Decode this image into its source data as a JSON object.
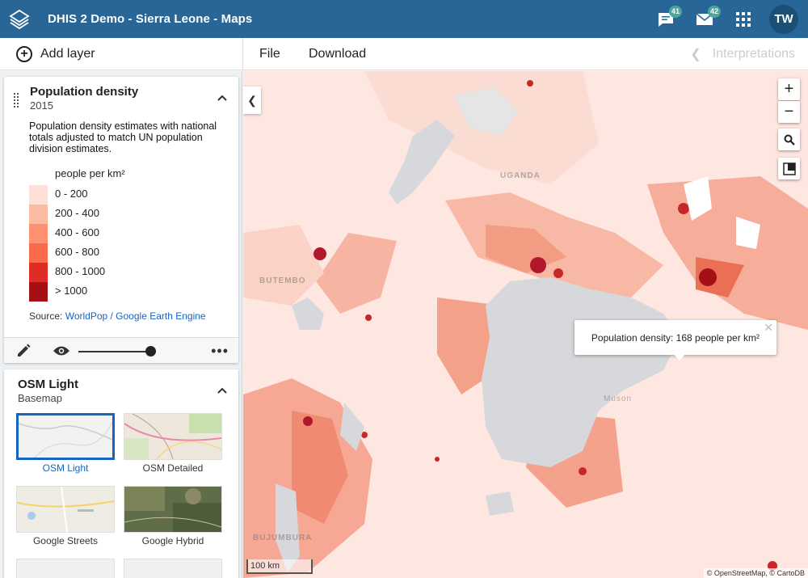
{
  "app": {
    "title": "DHIS 2 Demo - Sierra Leone - Maps",
    "messages_count": "41",
    "interpretations_count": "42",
    "user_initials": "TW"
  },
  "toolbar": {
    "add_layer": "Add layer",
    "file": "File",
    "download": "Download",
    "interpretations": "Interpretations"
  },
  "layer": {
    "title": "Population density",
    "period": "2015",
    "description": "Population density estimates with national totals adjusted to match UN population division estimates.",
    "legend_unit": "people per km²",
    "legend": [
      {
        "label": "0 - 200",
        "color": "#fee0d8"
      },
      {
        "label": "200 - 400",
        "color": "#fcbba1"
      },
      {
        "label": "400 - 600",
        "color": "#fc9272"
      },
      {
        "label": "600 - 800",
        "color": "#fb6a4a"
      },
      {
        "label": "800 - 1000",
        "color": "#de2d26"
      },
      {
        "label": "> 1000",
        "color": "#a50f15"
      }
    ],
    "source_prefix": "Source:",
    "source_link": "WorldPop / Google Earth Engine",
    "opacity": 0.9
  },
  "basemap": {
    "title": "OSM Light",
    "subtitle": "Basemap",
    "options": [
      {
        "label": "OSM Light",
        "selected": true
      },
      {
        "label": "OSM Detailed",
        "selected": false
      },
      {
        "label": "Google Streets",
        "selected": false
      },
      {
        "label": "Google Hybrid",
        "selected": false
      }
    ]
  },
  "map": {
    "popup": "Population density: 168 people per km²",
    "scale": "100 km",
    "attribution": "© OpenStreetMap, © CartoDB",
    "places": [
      "UGANDA",
      "BUTEMBO",
      "Muson",
      "BUJUMBURA"
    ]
  },
  "icons": [
    "apps-icon",
    "message-icon",
    "mail-icon",
    "search-icon",
    "fullscreen-icon",
    "pencil-icon",
    "eye-icon",
    "more-icon",
    "chevron-up-icon",
    "chevron-left-icon"
  ]
}
